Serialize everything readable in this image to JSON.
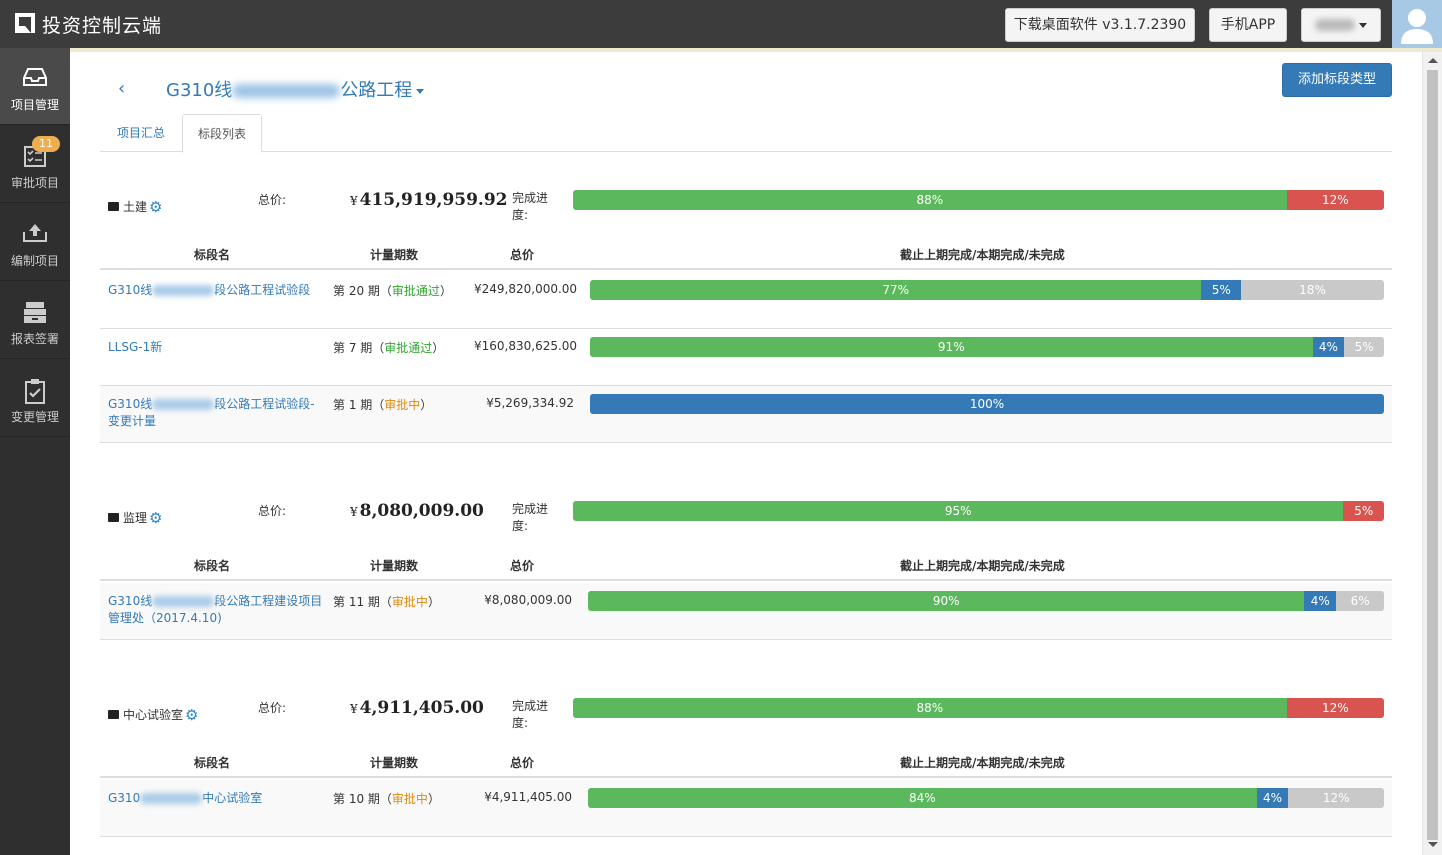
{
  "app": {
    "title": "投资控制云端",
    "download_label": "下载桌面软件 v3.1.7.2390",
    "mobile_app_label": "手机APP"
  },
  "sidebar": {
    "items": [
      {
        "label": "项目管理",
        "icon": "inbox-icon",
        "active": true
      },
      {
        "label": "审批项目",
        "icon": "checklist-icon",
        "badge": "11"
      },
      {
        "label": "编制项目",
        "icon": "upload-icon"
      },
      {
        "label": "报表签署",
        "icon": "archive-icon"
      },
      {
        "label": "变更管理",
        "icon": "clipboard-icon"
      }
    ]
  },
  "header": {
    "back_label": "‹",
    "title_prefix": "G310线",
    "title_suffix": "公路工程",
    "add_button_label": "添加标段类型"
  },
  "tabs": [
    {
      "label": "项目汇总",
      "active": false
    },
    {
      "label": "标段列表",
      "active": true
    }
  ],
  "columns": {
    "name": "标段名",
    "period": "计量期数",
    "total": "总价",
    "progress": "截止上期完成/本期完成/未完成"
  },
  "labels": {
    "total_price": "总价:",
    "completion": "完成进度:",
    "currency": "¥"
  },
  "colors": {
    "done": "#5cb85c",
    "current": "#337ab7",
    "remaining": "#c9c9c9",
    "incomplete": "#d9534f",
    "link": "#337ab7"
  },
  "groups": [
    {
      "name": "土建",
      "total": "415,919,959.92",
      "progress": {
        "done": 88,
        "incomplete": 12
      },
      "rows": [
        {
          "name_prefix": "G310线",
          "name_suffix": "段公路工程试验段",
          "period": "第 20 期",
          "status": "审批通过",
          "status_type": "ok",
          "price": "249,820,000.00",
          "done": 77,
          "current": 5,
          "remaining": 18
        },
        {
          "name_prefix": "LLSG-1新",
          "name_suffix": "",
          "period": "第 7 期",
          "status": "审批通过",
          "status_type": "ok",
          "price": "160,830,625.00",
          "done": 91,
          "current": 4,
          "remaining": 5
        },
        {
          "name_prefix": "G310线",
          "name_suffix": "段公路工程试验段-变更计量",
          "period": "第 1 期",
          "status": "审批中",
          "status_type": "pending",
          "price": "5,269,334.92",
          "done": 0,
          "current": 100,
          "remaining": 0
        }
      ]
    },
    {
      "name": "监理",
      "total": "8,080,009.00",
      "progress": {
        "done": 95,
        "incomplete": 5
      },
      "rows": [
        {
          "name_prefix": "G310线",
          "name_suffix": "段公路工程建设项目管理处（2017.4.10)",
          "period": "第 11 期",
          "status": "审批中",
          "status_type": "pending",
          "price": "8,080,009.00",
          "done": 90,
          "current": 4,
          "remaining": 6
        }
      ]
    },
    {
      "name": "中心试验室",
      "total": "4,911,405.00",
      "progress": {
        "done": 88,
        "incomplete": 12
      },
      "rows": [
        {
          "name_prefix": "G310",
          "name_suffix": "中心试验室",
          "period": "第 10 期",
          "status": "审批中",
          "status_type": "pending",
          "price": "4,911,405.00",
          "done": 84,
          "current": 4,
          "remaining": 12
        }
      ]
    }
  ]
}
